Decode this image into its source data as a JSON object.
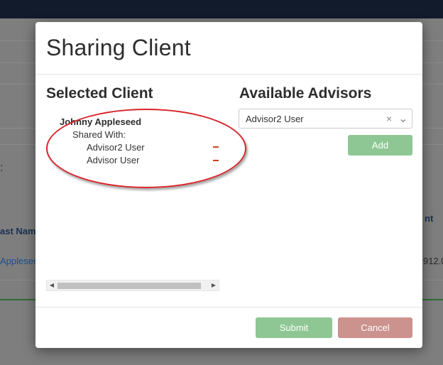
{
  "background": {
    "left_label_1": "ast Nam",
    "left_label_2": "Applesee",
    "left_marker": ":",
    "right_label_1": "nt",
    "right_label_2": "912.0"
  },
  "modal": {
    "title": "Sharing Client",
    "selected_client": {
      "heading": "Selected Client",
      "client_name": "Johnny Appleseed",
      "shared_with_label": "Shared With:",
      "advisors": [
        {
          "name": "Advisor2 User",
          "remove_label": "−"
        },
        {
          "name": "Advisor User",
          "remove_label": "−"
        }
      ]
    },
    "available_advisors": {
      "heading": "Available Advisors",
      "selected_value": "Advisor2 User",
      "clear_icon": "×",
      "chevron_icon": "⌄",
      "add_label": "Add"
    },
    "footer": {
      "submit_label": "Submit",
      "cancel_label": "Cancel"
    }
  },
  "colors": {
    "primary_button": "#8ec794",
    "cancel_button": "#cc928d",
    "annotation_ellipse": "#d8242a",
    "remove_dash": "#c8441f"
  }
}
